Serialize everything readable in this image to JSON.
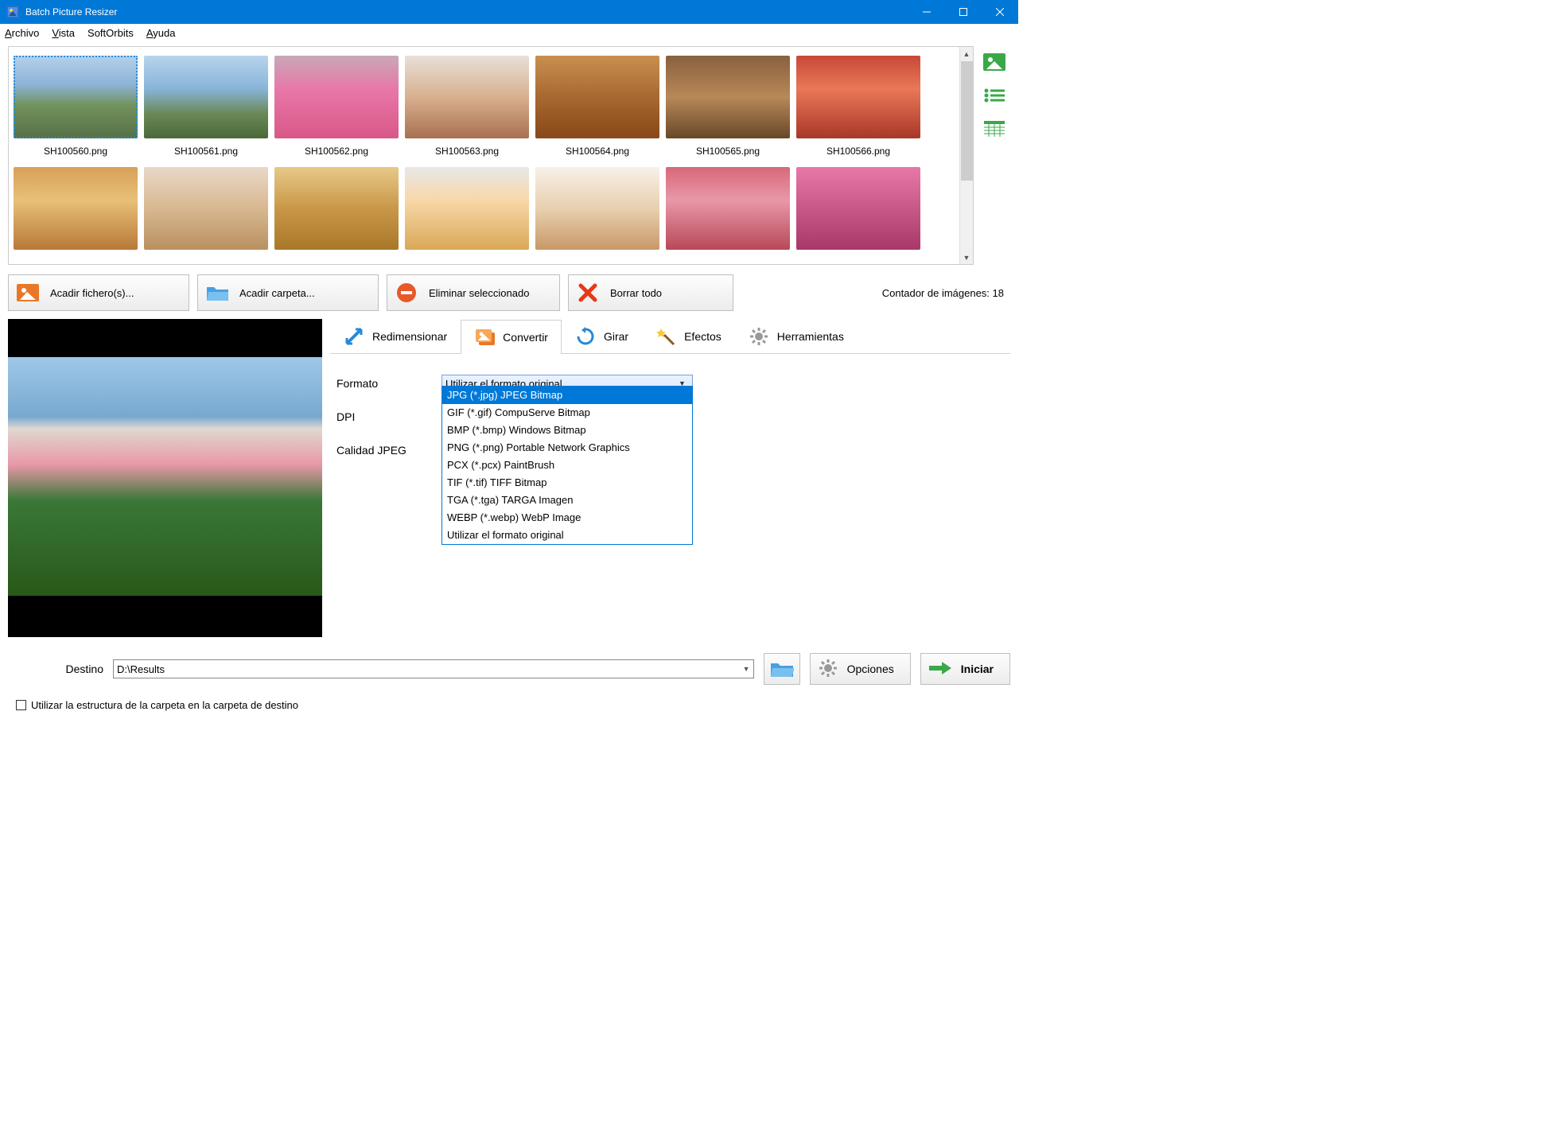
{
  "window": {
    "title": "Batch Picture Resizer"
  },
  "menu": {
    "file": "Archivo",
    "view": "Vista",
    "softorbits": "SoftOrbits",
    "help": "Ayuda"
  },
  "thumbnails": [
    {
      "name": "SH100560.png",
      "selected": true,
      "ph": "ph1"
    },
    {
      "name": "SH100561.png",
      "selected": false,
      "ph": "ph2"
    },
    {
      "name": "SH100562.png",
      "selected": false,
      "ph": "ph3"
    },
    {
      "name": "SH100563.png",
      "selected": false,
      "ph": "ph4"
    },
    {
      "name": "SH100564.png",
      "selected": false,
      "ph": "ph5"
    },
    {
      "name": "SH100565.png",
      "selected": false,
      "ph": "ph6"
    },
    {
      "name": "SH100566.png",
      "selected": false,
      "ph": "ph7"
    },
    {
      "name": "",
      "selected": false,
      "ph": "ph8"
    },
    {
      "name": "",
      "selected": false,
      "ph": "ph9"
    },
    {
      "name": "",
      "selected": false,
      "ph": "ph10"
    },
    {
      "name": "",
      "selected": false,
      "ph": "ph11"
    },
    {
      "name": "",
      "selected": false,
      "ph": "ph12"
    },
    {
      "name": "",
      "selected": false,
      "ph": "ph13"
    },
    {
      "name": "",
      "selected": false,
      "ph": "ph14"
    }
  ],
  "toolbar": {
    "add_files": "Acadir fichero(s)...",
    "add_folder": "Acadir carpeta...",
    "delete_selected": "Eliminar seleccionado",
    "clear_all": "Borrar todo",
    "counter": "Contador de imágenes: 18"
  },
  "tabs": {
    "resize": "Redimensionar",
    "convert": "Convertir",
    "rotate": "Girar",
    "effects": "Efectos",
    "tools": "Herramientas"
  },
  "convert": {
    "format_label": "Formato",
    "dpi_label": "DPI",
    "jpeg_quality_label": "Calidad JPEG",
    "format_selected": "Utilizar el formato original",
    "format_options": [
      "JPG (*.jpg) JPEG Bitmap",
      "GIF (*.gif) CompuServe Bitmap",
      "BMP (*.bmp) Windows Bitmap",
      "PNG (*.png) Portable Network Graphics",
      "PCX (*.pcx) PaintBrush",
      "TIF (*.tif) TIFF Bitmap",
      "TGA (*.tga) TARGA Imagen",
      "WEBP (*.webp) WebP Image",
      "Utilizar el formato original"
    ],
    "highlight_index": 0
  },
  "bottom": {
    "dest_label": "Destino",
    "dest_value": "D:\\Results",
    "options_label": "Opciones",
    "start_label": "Iniciar",
    "use_folder_structure": "Utilizar la estructura de la carpeta en la carpeta de destino"
  }
}
